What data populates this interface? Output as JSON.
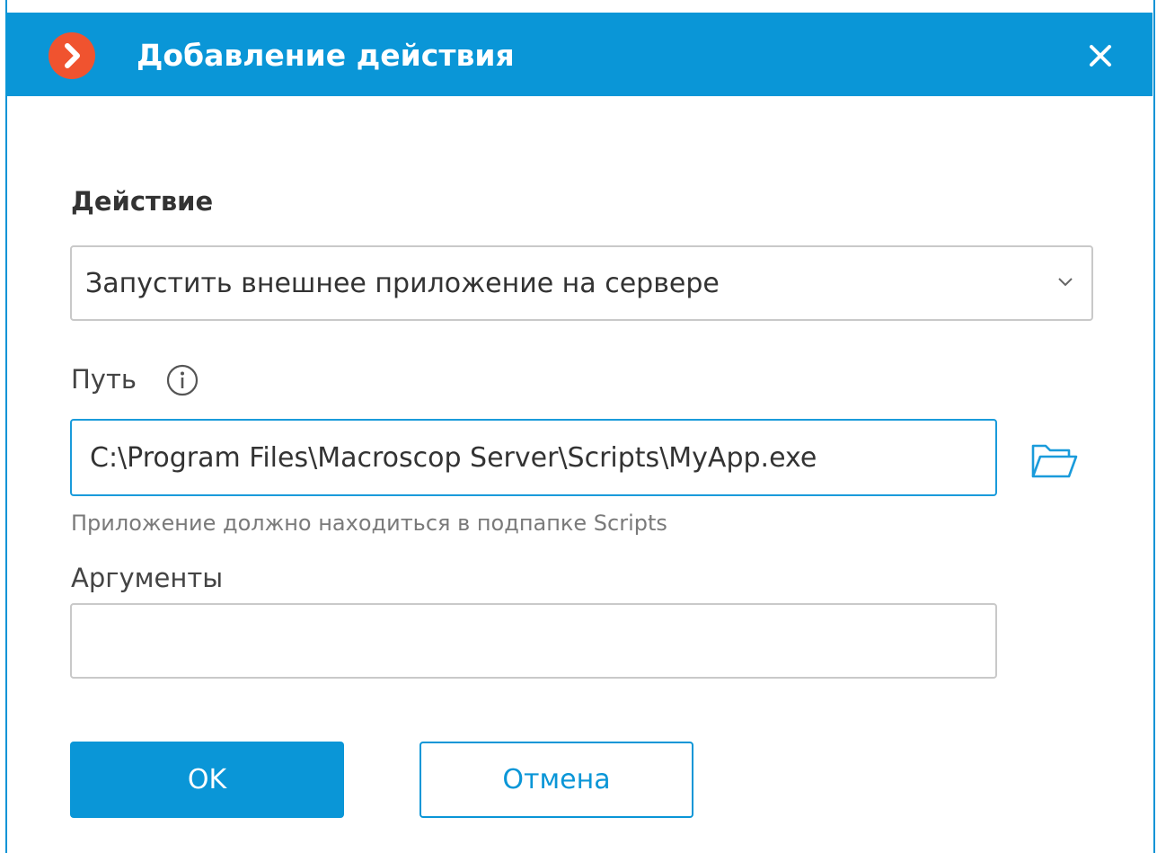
{
  "window": {
    "title": "Добавление действия",
    "logo_icon": "macroscop-logo-icon",
    "close_icon": "close-icon",
    "accent_color": "#0a96d7",
    "logo_color": "#f0532f"
  },
  "action_section": {
    "title": "Действие",
    "selected_action": "Запустить внешнее приложение на сервере",
    "dropdown_icon": "chevron-down-icon"
  },
  "path_field": {
    "label": "Путь",
    "info_icon": "info-icon",
    "value": "C:\\Program Files\\Macroscop Server\\Scripts\\MyApp.exe",
    "browse_icon": "folder-open-icon",
    "hint": "Приложение должно находиться в подпапке Scripts"
  },
  "arguments_field": {
    "label": "Аргументы",
    "value": ""
  },
  "buttons": {
    "ok_label": "OK",
    "cancel_label": "Отмена"
  }
}
